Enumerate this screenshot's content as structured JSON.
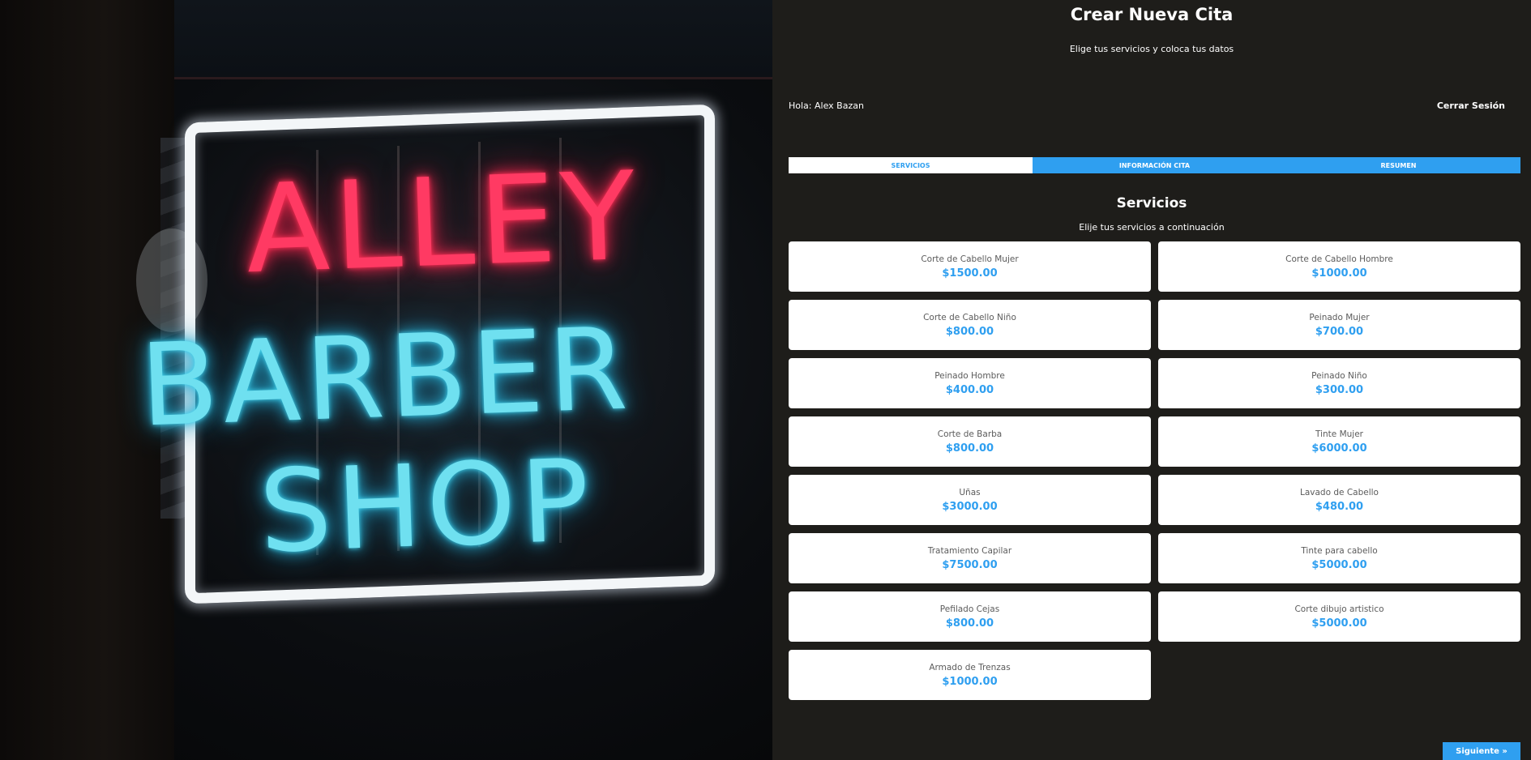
{
  "hero": {
    "sign_line1": "ALLEY",
    "sign_line2": "BARBER",
    "sign_line3": "SHOP"
  },
  "header": {
    "title": "Crear Nueva Cita",
    "subtitle": "Elige tus servicios y coloca tus datos"
  },
  "user": {
    "greeting": "Hola: Alex Bazan",
    "logout_label": "Cerrar Sesión"
  },
  "tabs": [
    {
      "label": "SERVICIOS",
      "active": true
    },
    {
      "label": "INFORMACIÓN CITA",
      "active": false
    },
    {
      "label": "RESUMEN",
      "active": false
    }
  ],
  "section": {
    "title": "Servicios",
    "description": "Elije tus servicios a continuación"
  },
  "services": [
    {
      "name": "Corte de Cabello Mujer",
      "price": "$1500.00"
    },
    {
      "name": "Corte de Cabello Hombre",
      "price": "$1000.00"
    },
    {
      "name": "Corte de Cabello Niño",
      "price": "$800.00"
    },
    {
      "name": "Peinado Mujer",
      "price": "$700.00"
    },
    {
      "name": "Peinado Hombre",
      "price": "$400.00"
    },
    {
      "name": "Peinado Niño",
      "price": "$300.00"
    },
    {
      "name": "Corte de Barba",
      "price": "$800.00"
    },
    {
      "name": "Tinte Mujer",
      "price": "$6000.00"
    },
    {
      "name": "Uñas",
      "price": "$3000.00"
    },
    {
      "name": "Lavado de Cabello",
      "price": "$480.00"
    },
    {
      "name": "Tratamiento Capilar",
      "price": "$7500.00"
    },
    {
      "name": "Tinte para cabello",
      "price": "$5000.00"
    },
    {
      "name": "Pefilado Cejas",
      "price": "$800.00"
    },
    {
      "name": "Corte dibujo artistico",
      "price": "$5000.00"
    },
    {
      "name": "Armado de Trenzas",
      "price": "$1000.00"
    }
  ],
  "navigation": {
    "next_label": "Siguiente »"
  },
  "colors": {
    "accent": "#2f9ff0",
    "background": "#1e1d1a",
    "card": "#ffffff"
  }
}
